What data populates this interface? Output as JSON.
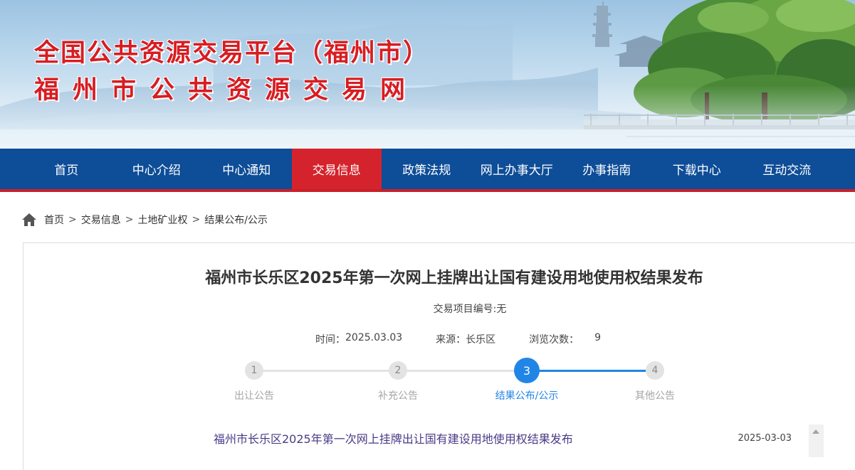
{
  "banner": {
    "title_line1": "全国公共资源交易平台（福州市）",
    "title_line2": "福州市公共资源交易网"
  },
  "nav": {
    "items": [
      {
        "label": "首页",
        "active": false
      },
      {
        "label": "中心介绍",
        "active": false
      },
      {
        "label": "中心通知",
        "active": false
      },
      {
        "label": "交易信息",
        "active": true
      },
      {
        "label": "政策法规",
        "active": false
      },
      {
        "label": "网上办事大厅",
        "active": false
      },
      {
        "label": "办事指南",
        "active": false
      },
      {
        "label": "下载中心",
        "active": false
      },
      {
        "label": "互动交流",
        "active": false
      }
    ]
  },
  "breadcrumb": {
    "items": [
      "首页",
      "交易信息",
      "土地矿业权",
      "结果公布/公示"
    ],
    "separator": ">"
  },
  "article": {
    "title": "福州市长乐区2025年第一次网上挂牌出让国有建设用地使用权结果发布",
    "project_no": "交易项目编号:无",
    "time_label": "时间：",
    "time_value": "2025.03.03",
    "source_label": "来源：",
    "source_value": "长乐区",
    "views_label": "浏览次数：",
    "views_value": "9"
  },
  "steps": {
    "items": [
      {
        "number": "1",
        "label": "出让公告"
      },
      {
        "number": "2",
        "label": "补充公告"
      },
      {
        "number": "3",
        "label": "结果公布/公示"
      },
      {
        "number": "4",
        "label": "其他公告"
      }
    ],
    "current": 3
  },
  "list": {
    "items": [
      {
        "title": "福州市长乐区2025年第一次网上挂牌出让国有建设用地使用权结果发布",
        "date": "2025-03-03"
      }
    ]
  },
  "colors": {
    "nav_bg": "#0e4d97",
    "nav_active": "#d4232c",
    "title_red": "#d71d22",
    "step_active": "#2185e6",
    "link_purple": "#4a3a87"
  }
}
